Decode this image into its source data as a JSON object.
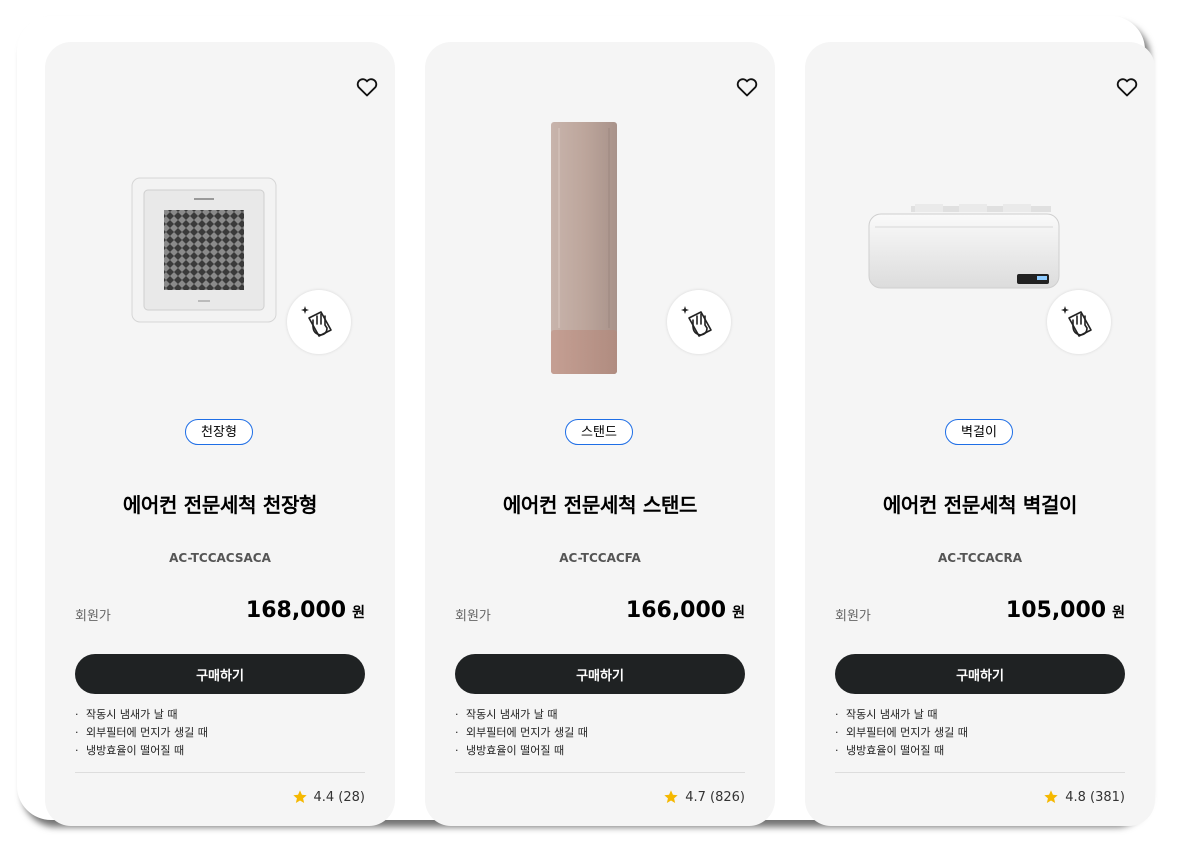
{
  "colors": {
    "accent": "#1e6ee6",
    "button_bg": "#1f2223",
    "star": "#f5b800",
    "card_bg": "#f5f5f5"
  },
  "products": [
    {
      "tag": "천장형",
      "title": "에어컨 전문세척 천장형",
      "model": "AC-TCCACSACA",
      "price_label": "회원가",
      "price": "168,000",
      "currency": "원",
      "buy_label": "구매하기",
      "bullets": [
        "작동시 냄새가 날 때",
        "외부필터에 먼지가 생길 때",
        "냉방효율이 떨어질 때"
      ],
      "rating": "4.4 (28)"
    },
    {
      "tag": "스탠드",
      "title": "에어컨 전문세척 스탠드",
      "model": "AC-TCCACFA",
      "price_label": "회원가",
      "price": "166,000",
      "currency": "원",
      "buy_label": "구매하기",
      "bullets": [
        "작동시 냄새가 날 때",
        "외부필터에 먼지가 생길 때",
        "냉방효율이 떨어질 때"
      ],
      "rating": "4.7 (826)"
    },
    {
      "tag": "벽걸이",
      "title": "에어컨 전문세척 벽걸이",
      "model": "AC-TCCACRA",
      "price_label": "회원가",
      "price": "105,000",
      "currency": "원",
      "buy_label": "구매하기",
      "bullets": [
        "작동시 냄새가 날 때",
        "외부필터에 먼지가 생길 때",
        "냉방효율이 떨어질 때"
      ],
      "rating": "4.8 (381)"
    }
  ]
}
